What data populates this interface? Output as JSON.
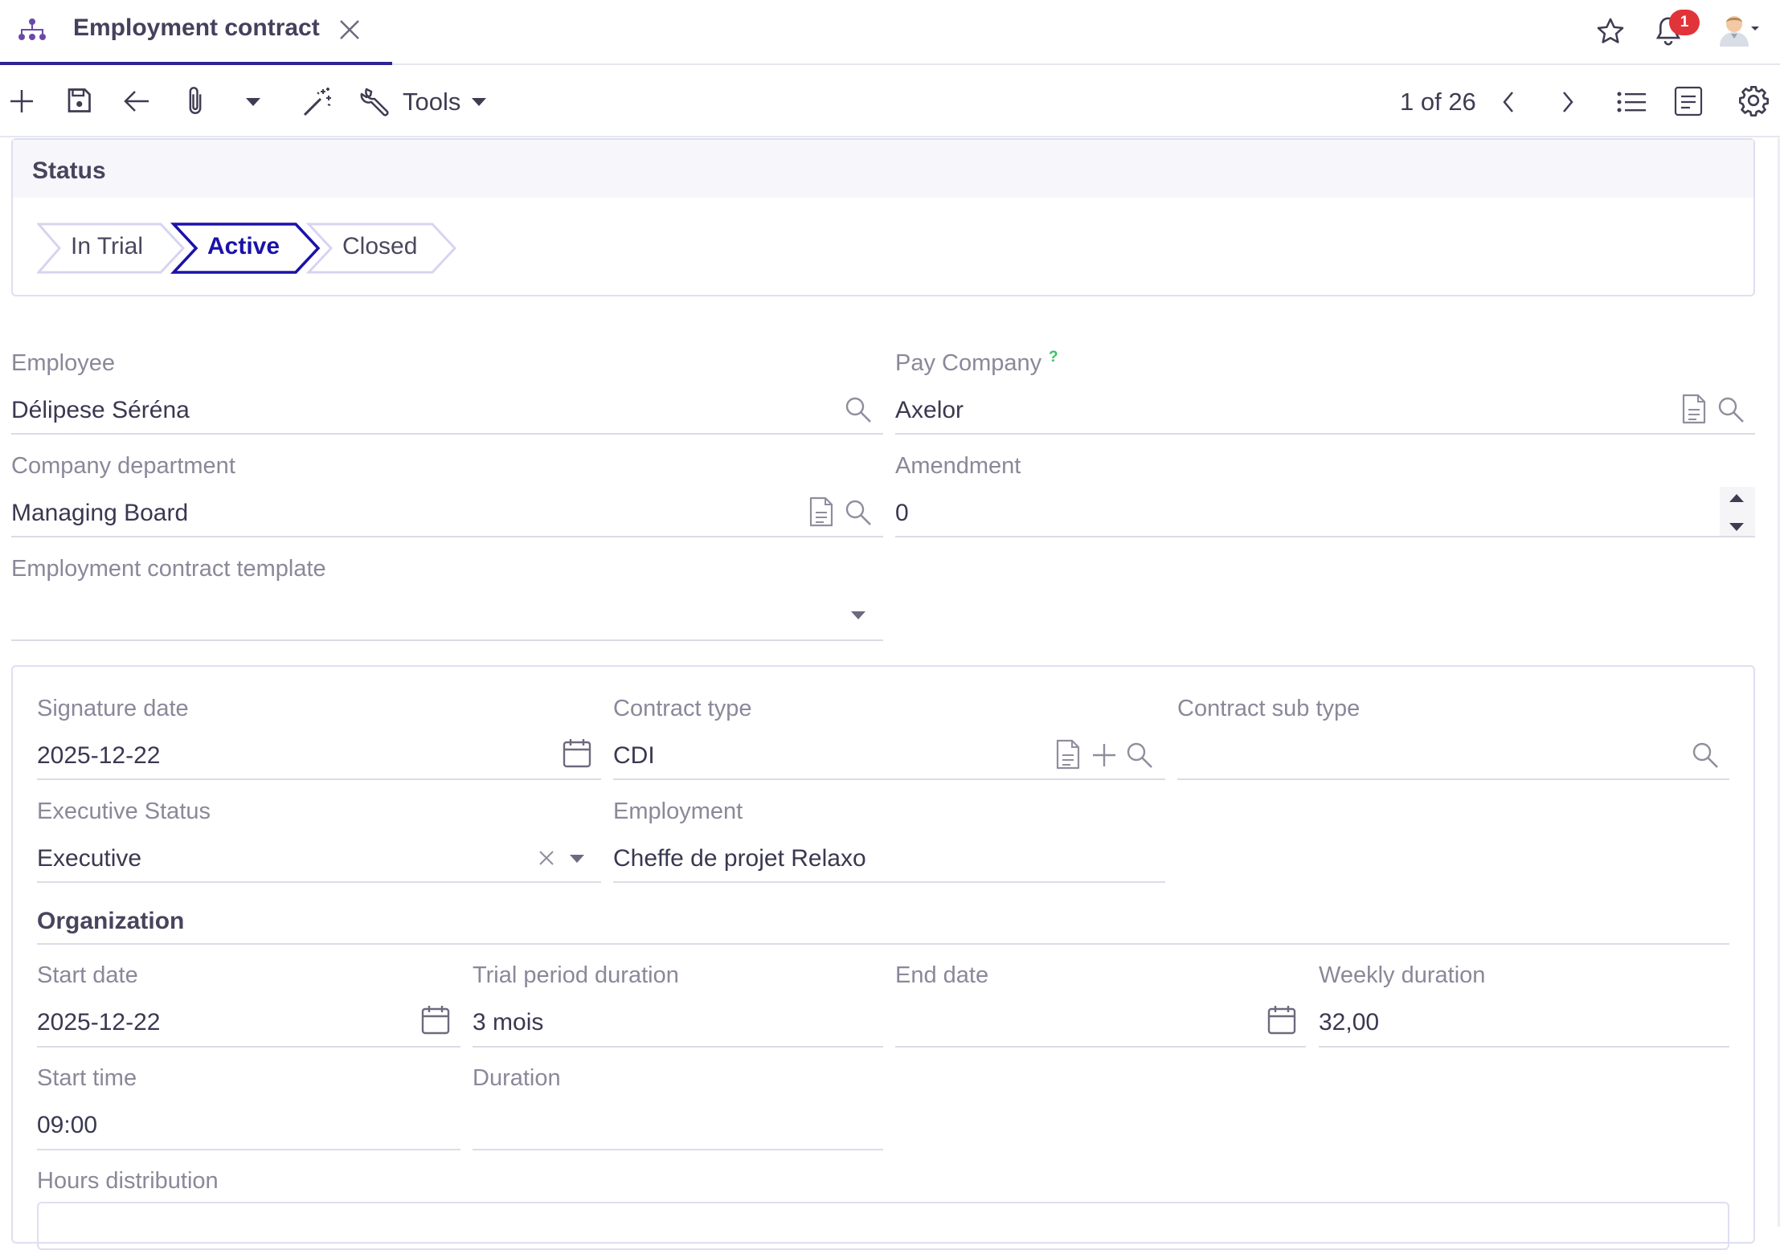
{
  "tab": {
    "title": "Employment contract",
    "icon": "org-chart-icon"
  },
  "header": {
    "notification_count": "1"
  },
  "toolbar": {
    "tools_label": "Tools",
    "pager_text": "1 of 26"
  },
  "status": {
    "section_title": "Status",
    "steps": [
      "In Trial",
      "Active",
      "Closed"
    ],
    "active_step": "Active",
    "accent": "#1b12a8"
  },
  "form": {
    "employee": {
      "label": "Employee",
      "value": "Délipese Séréna"
    },
    "pay_company": {
      "label": "Pay Company",
      "help": "?",
      "value": "Axelor"
    },
    "company_department": {
      "label": "Company department",
      "value": "Managing Board"
    },
    "amendment": {
      "label": "Amendment",
      "value": "0"
    },
    "contract_template": {
      "label": "Employment contract template",
      "value": ""
    },
    "signature_date": {
      "label": "Signature date",
      "value": "2025-12-22"
    },
    "contract_type": {
      "label": "Contract type",
      "value": "CDI"
    },
    "contract_sub_type": {
      "label": "Contract sub type",
      "value": ""
    },
    "executive_status": {
      "label": "Executive Status",
      "value": "Executive"
    },
    "employment": {
      "label": "Employment",
      "value": "Cheffe de projet Relaxo"
    },
    "organization_title": "Organization",
    "start_date": {
      "label": "Start date",
      "value": "2025-12-22"
    },
    "trial_period": {
      "label": "Trial period duration",
      "value": "3 mois"
    },
    "end_date": {
      "label": "End date",
      "value": ""
    },
    "weekly_duration": {
      "label": "Weekly duration",
      "value": "32,00"
    },
    "start_time": {
      "label": "Start time",
      "value": "09:00"
    },
    "duration": {
      "label": "Duration",
      "value": ""
    },
    "hours_distribution": {
      "label": "Hours distribution"
    }
  }
}
